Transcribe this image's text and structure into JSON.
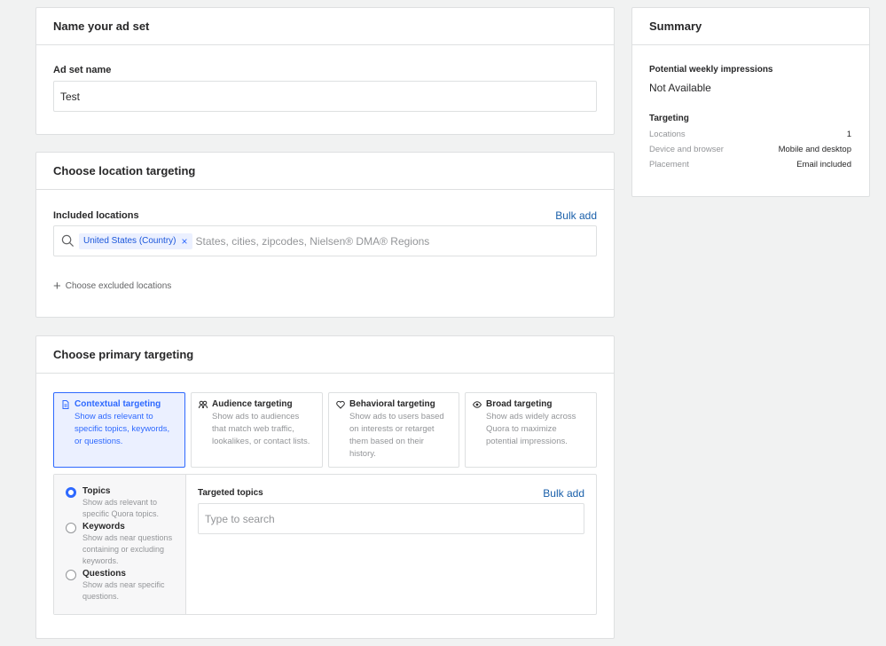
{
  "name_card": {
    "title": "Name your ad set",
    "field_label": "Ad set name",
    "field_value": "Test"
  },
  "location_card": {
    "title": "Choose location targeting",
    "included_label": "Included locations",
    "bulk_add": "Bulk add",
    "chip": "United States (Country)",
    "chip_remove": "×",
    "placeholder": "States, cities, zipcodes, Nielsen® DMA® Regions",
    "excluded_link": "Choose excluded locations",
    "excluded_plus": "+"
  },
  "primary_card": {
    "title": "Choose primary targeting",
    "options": [
      {
        "icon": "document-icon",
        "title": "Contextual targeting",
        "desc": "Show ads relevant to specific topics, keywords, or questions.",
        "selected": true
      },
      {
        "icon": "people-icon",
        "title": "Audience targeting",
        "desc": "Show ads to audiences that match web traffic, lookalikes, or contact lists.",
        "selected": false
      },
      {
        "icon": "heart-icon",
        "title": "Behavioral targeting",
        "desc": "Show ads to users based on interests or retarget them based on their history.",
        "selected": false
      },
      {
        "icon": "eye-icon",
        "title": "Broad targeting",
        "desc": "Show ads widely across Quora to maximize potential impressions.",
        "selected": false
      }
    ],
    "sub_options": [
      {
        "label": "Topics",
        "desc": "Show ads relevant to specific Quora topics.",
        "checked": true
      },
      {
        "label": "Keywords",
        "desc": "Show ads near questions containing or excluding keywords.",
        "checked": false
      },
      {
        "label": "Questions",
        "desc": "Show ads near specific questions.",
        "checked": false
      }
    ],
    "targeted_label": "Targeted topics",
    "bulk_add": "Bulk add",
    "search_placeholder": "Type to search"
  },
  "summary": {
    "title": "Summary",
    "impressions_label": "Potential weekly impressions",
    "impressions_value": "Not Available",
    "targeting_label": "Targeting",
    "rows": [
      {
        "key": "Locations",
        "value": "1"
      },
      {
        "key": "Device and browser",
        "value": "Mobile and desktop"
      },
      {
        "key": "Placement",
        "value": "Email included"
      }
    ]
  },
  "colors": {
    "accent": "#2e69ff",
    "selected_bg": "#ebf0ff",
    "border": "#dee0e1",
    "muted": "#939598"
  }
}
